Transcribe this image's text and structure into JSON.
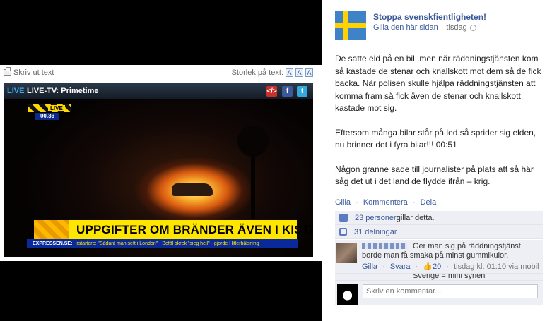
{
  "article": {
    "print_label": "Skriv ut text",
    "size_label": "Storlek på text:",
    "size_buttons": [
      "A",
      "A",
      "A"
    ]
  },
  "video": {
    "live_label": "LIVE",
    "channel": "LIVE-TV: Primetime",
    "badge_live": "LIVE",
    "badge_time": "00.36",
    "headline": "UPPGIFTER OM BRÄNDER ÄVEN I KISTA",
    "ticker_label": "EXPRESSEN.SE:",
    "ticker_text": "rstartare: \"Sådant man sett i London\"  ·  Befäl skrek \"sieg heil\" - gjorde Hitlerhälsning"
  },
  "post": {
    "page_name": "Stoppa svenskfientligheten!",
    "like_page": "Gilla den här sidan",
    "time": "tisdag",
    "paragraphs": [
      "De satte eld på en bil, men när räddningstjänsten kom så kastade de stenar och knallskott mot dem så de fick backa. När polisen skulle hjälpa räddningstjänsten att komma fram så fick även de stenar och knallskott kastade mot sig.",
      "Eftersom många bilar står på led så sprider sig elden, nu brinner det i fyra bilar!!! 00:51",
      "Någon granne sade till journalister på plats att så här såg det ut i det land de flydde ifrån – krig."
    ],
    "actions": {
      "like": "Gilla",
      "comment": "Kommentera",
      "share": "Dela"
    },
    "likes_count": "23 personer",
    "likes_suffix": " gillar detta.",
    "shares": "31 delningar",
    "comments": [
      {
        "text": "Ger man sig på räddningstjänst borde man få smaka på minst gummikulor.",
        "like": "Gilla",
        "reply": "Svara",
        "likes": "20",
        "time": "tisdag kl. 01:10 via mobil"
      },
      {
        "text": "Sverige = mini syrien"
      }
    ],
    "composer_placeholder": "Skriv en kommentar..."
  },
  "colors": {
    "fb_link": "#3b5998",
    "ticker_blue": "#0a2a9c",
    "headline_yellow": "#ffe600"
  },
  "icons": [
    "printer-icon",
    "embed-icon",
    "facebook-icon",
    "twitter-icon",
    "globe-icon",
    "thumbs-up-icon",
    "share-icon"
  ]
}
